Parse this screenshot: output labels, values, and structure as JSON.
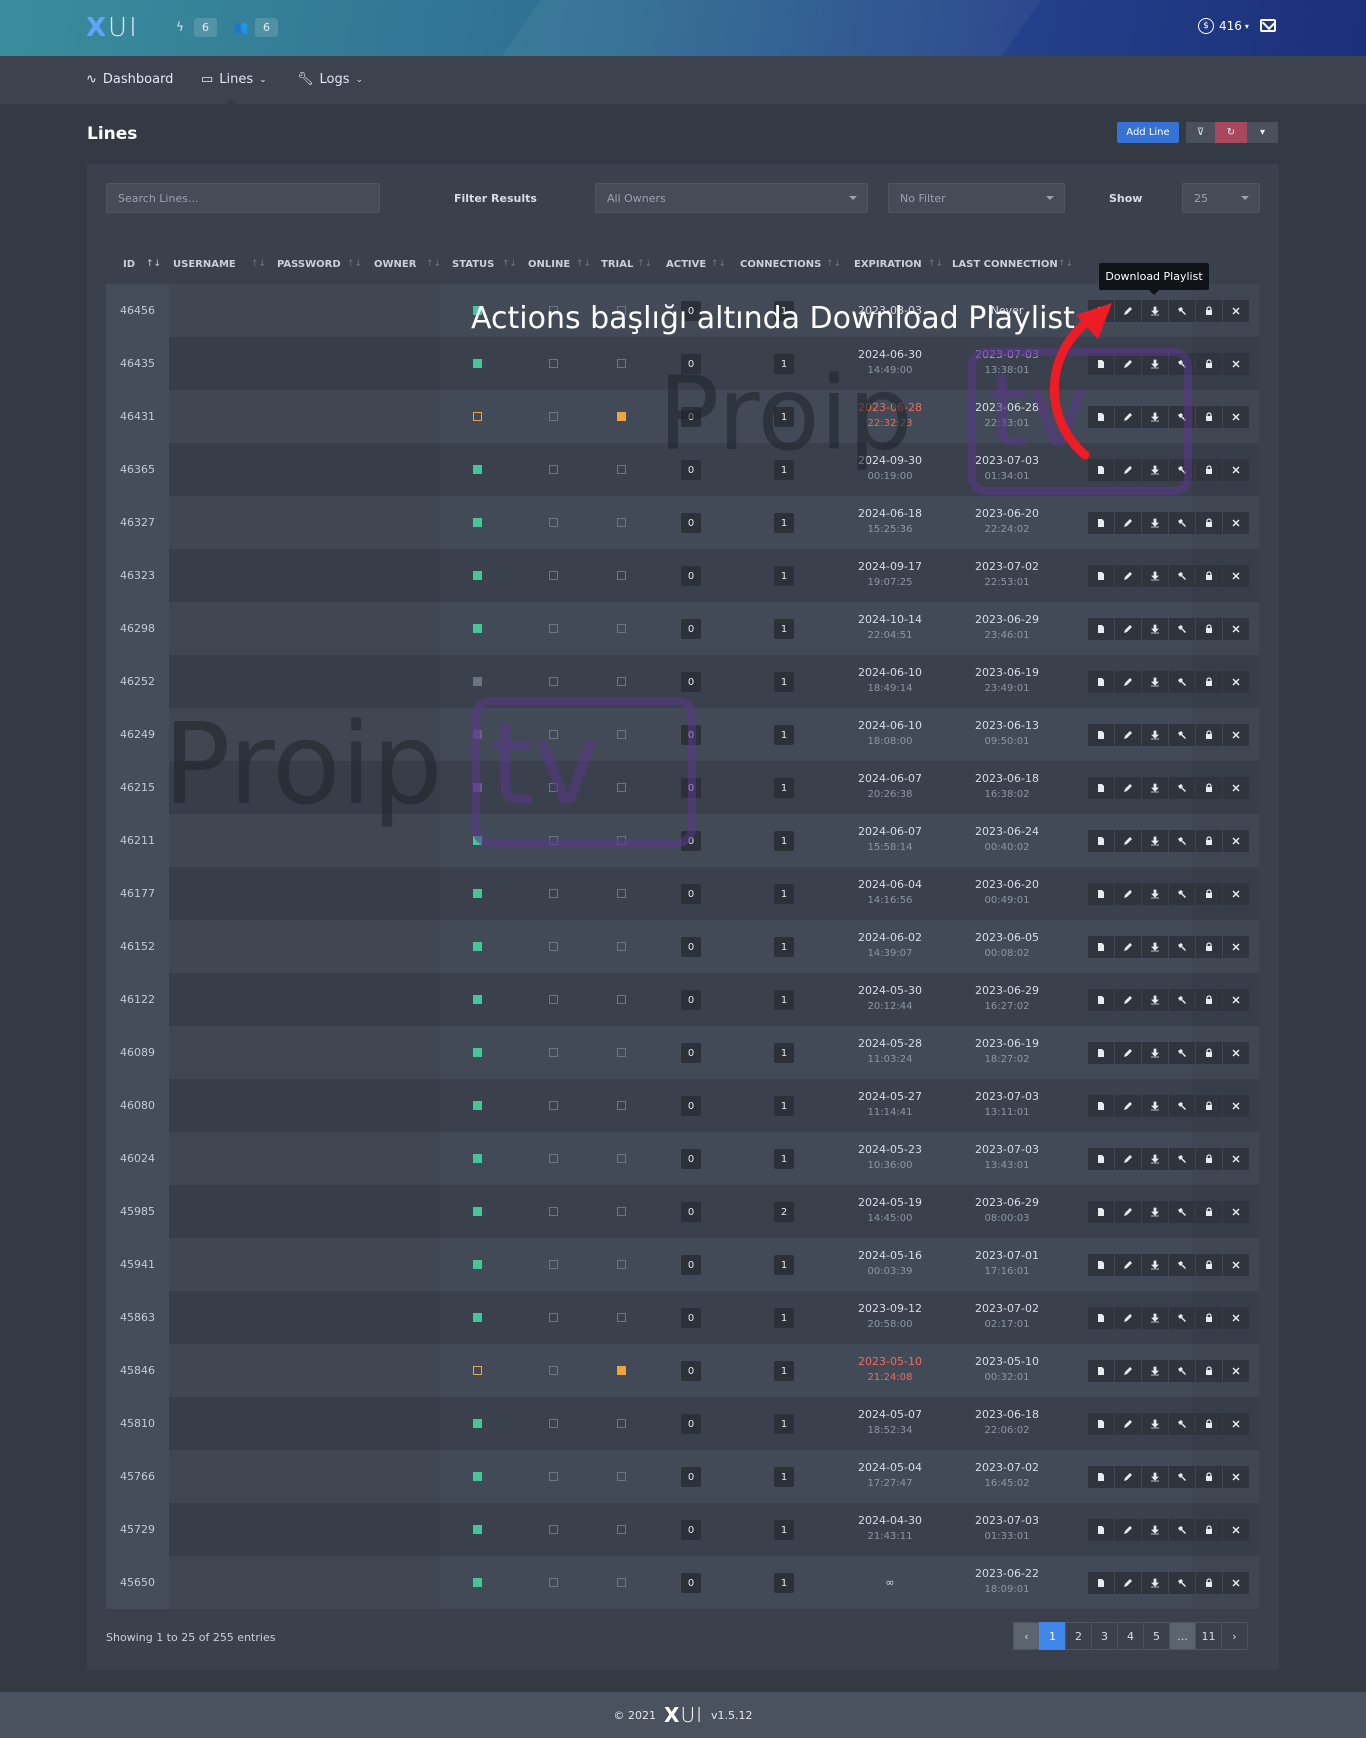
{
  "header": {
    "logo_x": "X",
    "logo_rest": "UI",
    "badge1": "6",
    "badge2": "6",
    "credits": "416"
  },
  "nav": {
    "dashboard": "Dashboard",
    "lines": "Lines",
    "logs": "Logs"
  },
  "page": {
    "title": "Lines",
    "add_line": "Add Line"
  },
  "controls": {
    "search_placeholder": "Search Lines...",
    "filter_label": "Filter Results",
    "owner_value": "All Owners",
    "filter_value": "No Filter",
    "show_label": "Show",
    "show_value": "25"
  },
  "table": {
    "headers": {
      "id": "ID",
      "username": "USERNAME",
      "password": "PASSWORD",
      "owner": "OWNER",
      "status": "STATUS",
      "online": "ONLINE",
      "trial": "TRIAL",
      "active": "ACTIVE",
      "connections": "CONNECTIONS",
      "expiration": "EXPIRATION",
      "last_connection": "LAST CONNECTION"
    },
    "rows": [
      {
        "id": "46456",
        "active": "0",
        "conn": "1",
        "exp_d": "2023-08-03",
        "exp_t": "",
        "last_d": "Never",
        "last_t": "",
        "status": "green",
        "trial": "empty"
      },
      {
        "id": "46435",
        "active": "0",
        "conn": "1",
        "exp_d": "2024-06-30",
        "exp_t": "14:49:00",
        "last_d": "2023-07-03",
        "last_t": "13:38:01",
        "status": "green",
        "trial": "empty",
        "last_style": "purple"
      },
      {
        "id": "46431",
        "active": "0",
        "conn": "1",
        "exp_d": "2023-06-28",
        "exp_t": "22:32:23",
        "last_d": "2023-06-28",
        "last_t": "22:33:01",
        "status": "orange-out",
        "trial": "orange-fill",
        "exp_style": "red"
      },
      {
        "id": "46365",
        "active": "0",
        "conn": "1",
        "exp_d": "2024-09-30",
        "exp_t": "00:19:00",
        "last_d": "2023-07-03",
        "last_t": "01:34:01",
        "status": "green",
        "trial": "empty"
      },
      {
        "id": "46327",
        "active": "0",
        "conn": "1",
        "exp_d": "2024-06-18",
        "exp_t": "15:25:36",
        "last_d": "2023-06-20",
        "last_t": "22:24:02",
        "status": "green",
        "trial": "empty"
      },
      {
        "id": "46323",
        "active": "0",
        "conn": "1",
        "exp_d": "2024-09-17",
        "exp_t": "19:07:25",
        "last_d": "2023-07-02",
        "last_t": "22:53:01",
        "status": "green",
        "trial": "empty"
      },
      {
        "id": "46298",
        "active": "0",
        "conn": "1",
        "exp_d": "2024-10-14",
        "exp_t": "22:04:51",
        "last_d": "2023-06-29",
        "last_t": "23:46:01",
        "status": "green",
        "trial": "empty"
      },
      {
        "id": "46252",
        "active": "0",
        "conn": "1",
        "exp_d": "2024-06-10",
        "exp_t": "18:49:14",
        "last_d": "2023-06-19",
        "last_t": "23:49:01",
        "status": "gray",
        "trial": "empty"
      },
      {
        "id": "46249",
        "active": "0",
        "conn": "1",
        "exp_d": "2024-06-10",
        "exp_t": "18:08:00",
        "last_d": "2023-06-13",
        "last_t": "09:50:01",
        "status": "purple",
        "trial": "empty"
      },
      {
        "id": "46215",
        "active": "0",
        "conn": "1",
        "exp_d": "2024-06-07",
        "exp_t": "20:26:38",
        "last_d": "2023-06-18",
        "last_t": "16:38:02",
        "status": "purple",
        "trial": "empty"
      },
      {
        "id": "46211",
        "active": "0",
        "conn": "1",
        "exp_d": "2024-06-07",
        "exp_t": "15:58:14",
        "last_d": "2023-06-24",
        "last_t": "00:40:02",
        "status": "green",
        "trial": "empty"
      },
      {
        "id": "46177",
        "active": "0",
        "conn": "1",
        "exp_d": "2024-06-04",
        "exp_t": "14:16:56",
        "last_d": "2023-06-20",
        "last_t": "00:49:01",
        "status": "green",
        "trial": "empty"
      },
      {
        "id": "46152",
        "active": "0",
        "conn": "1",
        "exp_d": "2024-06-02",
        "exp_t": "14:39:07",
        "last_d": "2023-06-05",
        "last_t": "00:08:02",
        "status": "green",
        "trial": "empty"
      },
      {
        "id": "46122",
        "active": "0",
        "conn": "1",
        "exp_d": "2024-05-30",
        "exp_t": "20:12:44",
        "last_d": "2023-06-29",
        "last_t": "16:27:02",
        "status": "green",
        "trial": "empty"
      },
      {
        "id": "46089",
        "active": "0",
        "conn": "1",
        "exp_d": "2024-05-28",
        "exp_t": "11:03:24",
        "last_d": "2023-06-19",
        "last_t": "18:27:02",
        "status": "green",
        "trial": "empty"
      },
      {
        "id": "46080",
        "active": "0",
        "conn": "1",
        "exp_d": "2024-05-27",
        "exp_t": "11:14:41",
        "last_d": "2023-07-03",
        "last_t": "13:11:01",
        "status": "green",
        "trial": "empty"
      },
      {
        "id": "46024",
        "active": "0",
        "conn": "1",
        "exp_d": "2024-05-23",
        "exp_t": "10:36:00",
        "last_d": "2023-07-03",
        "last_t": "13:43:01",
        "status": "green",
        "trial": "empty"
      },
      {
        "id": "45985",
        "active": "0",
        "conn": "2",
        "exp_d": "2024-05-19",
        "exp_t": "14:45:00",
        "last_d": "2023-06-29",
        "last_t": "08:00:03",
        "status": "green",
        "trial": "empty"
      },
      {
        "id": "45941",
        "active": "0",
        "conn": "1",
        "exp_d": "2024-05-16",
        "exp_t": "00:03:39",
        "last_d": "2023-07-01",
        "last_t": "17:16:01",
        "status": "green",
        "trial": "empty"
      },
      {
        "id": "45863",
        "active": "0",
        "conn": "1",
        "exp_d": "2023-09-12",
        "exp_t": "20:58:00",
        "last_d": "2023-07-02",
        "last_t": "02:17:01",
        "status": "green",
        "trial": "empty"
      },
      {
        "id": "45846",
        "active": "0",
        "conn": "1",
        "exp_d": "2023-05-10",
        "exp_t": "21:24:08",
        "last_d": "2023-05-10",
        "last_t": "00:32:01",
        "status": "orange-out",
        "trial": "orange-fill",
        "exp_style": "red"
      },
      {
        "id": "45810",
        "active": "0",
        "conn": "1",
        "exp_d": "2024-05-07",
        "exp_t": "18:52:34",
        "last_d": "2023-06-18",
        "last_t": "22:06:02",
        "status": "green",
        "trial": "empty"
      },
      {
        "id": "45766",
        "active": "0",
        "conn": "1",
        "exp_d": "2024-05-04",
        "exp_t": "17:27:47",
        "last_d": "2023-07-02",
        "last_t": "16:45:02",
        "status": "green",
        "trial": "empty"
      },
      {
        "id": "45729",
        "active": "0",
        "conn": "1",
        "exp_d": "2024-04-30",
        "exp_t": "21:43:11",
        "last_d": "2023-07-03",
        "last_t": "01:33:01",
        "status": "green",
        "trial": "empty"
      },
      {
        "id": "45650",
        "active": "0",
        "conn": "1",
        "exp_d": "∞",
        "exp_t": "",
        "last_d": "2023-06-22",
        "last_t": "18:09:01",
        "status": "green",
        "trial": "empty"
      }
    ]
  },
  "tooltip": "Download Playlist",
  "annotation": "Actions başlığı altında Download Playlist",
  "watermark": {
    "word": "Proip",
    "tv": "tv"
  },
  "footer_info": "Showing 1 to 25 of 255 entries",
  "pagination": [
    "‹",
    "1",
    "2",
    "3",
    "4",
    "5",
    "...",
    "11",
    "›"
  ],
  "site_footer": {
    "copy": "© 2021",
    "logo_x": "X",
    "logo_rest": "UI",
    "version": "v1.5.12"
  },
  "colors": {
    "accent": "#3672d6",
    "status_ok": "#44c699",
    "warning": "#f1a43a",
    "expired": "#f26a5a"
  }
}
